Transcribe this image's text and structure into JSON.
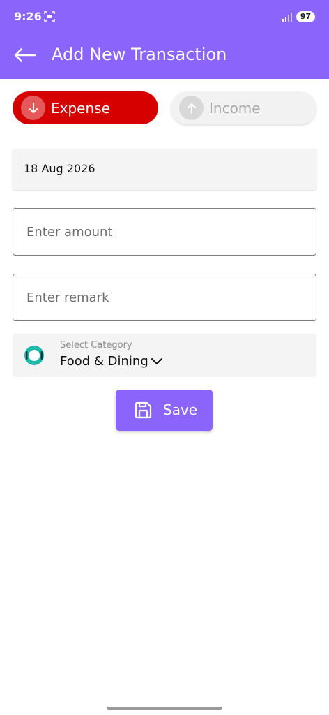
{
  "theme": {
    "accent": "#8a64fb",
    "expense": "#d60000"
  },
  "status_bar": {
    "time": "9:26",
    "battery": "97",
    "screenshot_icon": "screenshot-icon",
    "signal_icon": "signal-icon"
  },
  "header": {
    "title": "Add New Transaction",
    "back_icon": "arrow-left-icon"
  },
  "type_toggle": {
    "expense_label": "Expense",
    "income_label": "Income",
    "selected": "Expense",
    "expense_icon": "arrow-down-icon",
    "income_icon": "arrow-up-icon"
  },
  "form": {
    "date": "18 Aug 2026",
    "amount": {
      "value": "",
      "placeholder": "Enter amount"
    },
    "remark": {
      "value": "",
      "placeholder": "Enter remark"
    },
    "category": {
      "caption": "Select Category",
      "value": "Food & Dining",
      "icon": "food-dining-icon"
    },
    "save_label": "Save",
    "save_icon": "floppy-disk-icon"
  }
}
